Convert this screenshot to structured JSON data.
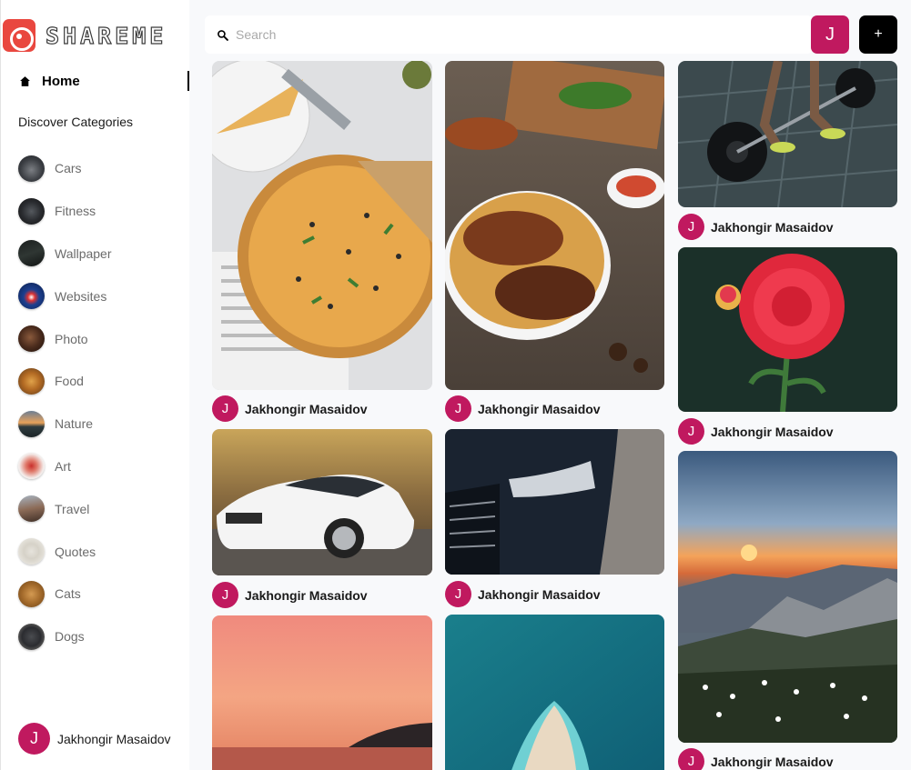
{
  "app": {
    "logo_text": "SHAREME"
  },
  "sidebar": {
    "home_label": "Home",
    "discover_label": "Discover Categories",
    "categories": [
      {
        "label": "Cars"
      },
      {
        "label": "Fitness"
      },
      {
        "label": "Wallpaper"
      },
      {
        "label": "Websites"
      },
      {
        "label": "Photo"
      },
      {
        "label": "Food"
      },
      {
        "label": "Nature"
      },
      {
        "label": "Art"
      },
      {
        "label": "Travel"
      },
      {
        "label": "Quotes"
      },
      {
        "label": "Cats"
      },
      {
        "label": "Dogs"
      }
    ]
  },
  "current_user": {
    "name": "Jakhongir Masaidov",
    "initial": "J"
  },
  "search": {
    "placeholder": "Search",
    "value": ""
  },
  "header": {
    "avatar_initial": "J",
    "add_label": "+"
  },
  "pins": [
    {
      "author": "Jakhongir Masaidov",
      "initial": "J",
      "image": "pizza"
    },
    {
      "author": "Jakhongir Masaidov",
      "initial": "J",
      "image": "biryani"
    },
    {
      "author": "Jakhongir Masaidov",
      "initial": "J",
      "image": "fitness-barbell"
    },
    {
      "author": "Jakhongir Masaidov",
      "initial": "J",
      "image": "red-dahlia"
    },
    {
      "author": "Jakhongir Masaidov",
      "initial": "J",
      "image": "white-car"
    },
    {
      "author": "Jakhongir Masaidov",
      "initial": "J",
      "image": "dark-car-headlight"
    },
    {
      "author": "Jakhongir Masaidov",
      "initial": "J",
      "image": "mountain-sunset"
    },
    {
      "author": "",
      "initial": "",
      "image": "pink-sunset"
    },
    {
      "author": "",
      "initial": "",
      "image": "beach-aerial"
    }
  ],
  "colors": {
    "accent": "#c0195f",
    "logo_red": "#e9473f",
    "background": "#f8f9fb",
    "add_button": "#000000"
  }
}
